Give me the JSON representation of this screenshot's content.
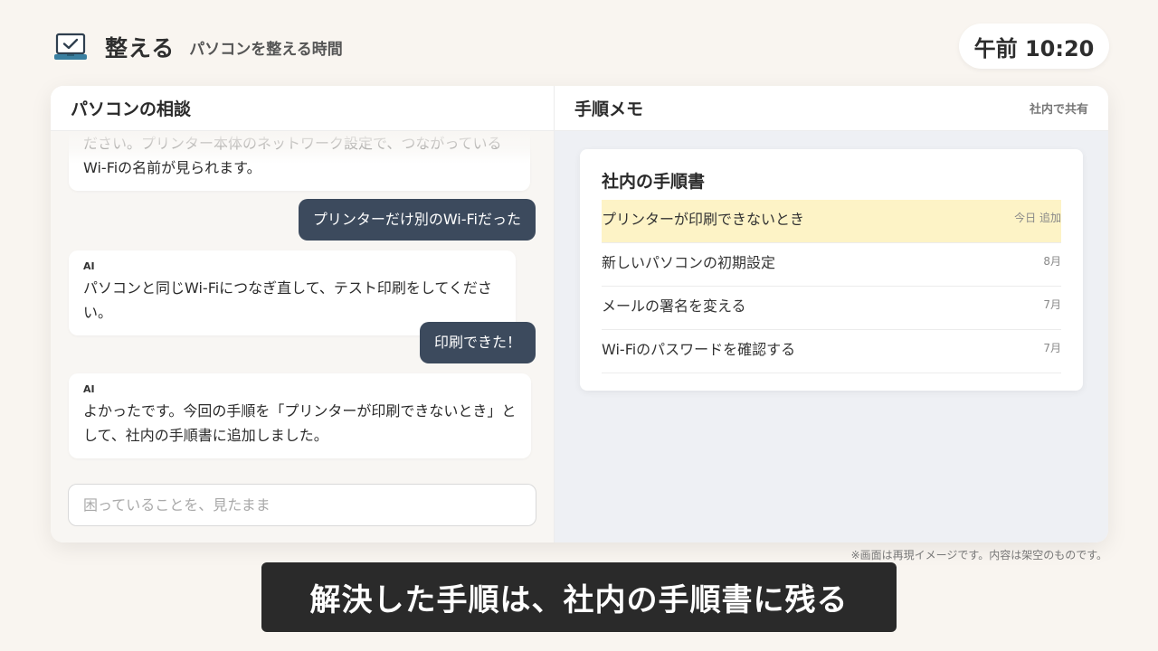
{
  "app": {
    "title": "整える",
    "subtitle": "パソコンを整える時間",
    "clock": "午前 10:20"
  },
  "chat": {
    "title": "パソコンの相談",
    "messages": [
      {
        "role": "ai",
        "label": "",
        "text": "ださい。プリンター本体のネットワーク設定で、つながっているWi-Fiの名前が見られます。"
      },
      {
        "role": "user",
        "text": "プリンターだけ別のWi-Fiだった"
      },
      {
        "role": "ai",
        "label": "AI",
        "text": "パソコンと同じWi-Fiにつなぎ直して、テスト印刷をしてください。"
      },
      {
        "role": "user",
        "text": "印刷できた！"
      },
      {
        "role": "ai",
        "label": "AI",
        "text": "よかったです。今回の手順を「プリンターが印刷できないとき」として、社内の手順書に追加しました。"
      }
    ],
    "input_placeholder": "困っていることを、見たまま",
    "input_value": ""
  },
  "memo": {
    "title": "手順メモ",
    "share_label": "社内で共有",
    "doc": {
      "title": "社内の手順書",
      "rows": [
        {
          "label": "プリンターが印刷できないとき",
          "date": "今日 追加",
          "highlighted": true
        },
        {
          "label": "新しいパソコンの初期設定",
          "date": "8月",
          "highlighted": false
        },
        {
          "label": "メールの署名を変える",
          "date": "7月",
          "highlighted": false
        },
        {
          "label": "Wi-Fiのパスワードを確認する",
          "date": "7月",
          "highlighted": false
        }
      ]
    }
  },
  "notice": "※画面は再現イメージです。内容は架空のものです。",
  "caption": "解決した手順は、社内の手順書に残る",
  "colors": {
    "background": "#f9f5f0",
    "user_bubble": "#3c4a5d",
    "highlight_row": "#fdf3c6",
    "caption_bg": "#2a2a2a",
    "icon_accent": "#3a7fa0"
  }
}
